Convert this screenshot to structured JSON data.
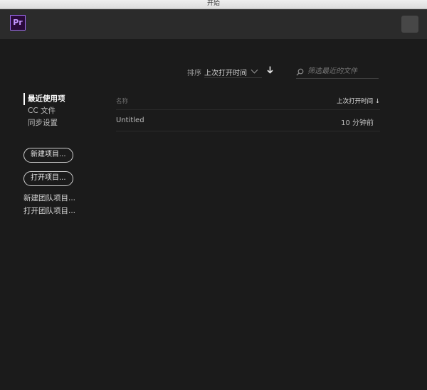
{
  "window": {
    "title": "开始"
  },
  "header": {
    "logo_text": "Pr"
  },
  "sort": {
    "label": "排序",
    "selected": "上次打开时间",
    "direction_icon": "arrow-down"
  },
  "search": {
    "placeholder": "筛选最近的文件",
    "value": ""
  },
  "sidebar": {
    "items": [
      {
        "label": "最近使用项",
        "active": true
      },
      {
        "label": "CC 文件",
        "active": false
      },
      {
        "label": "同步设置",
        "active": false
      }
    ]
  },
  "actions": {
    "new_project": "新建项目...",
    "open_project": "打开项目...",
    "new_team_project": "新建团队项目...",
    "open_team_project": "打开团队项目..."
  },
  "table": {
    "columns": {
      "name": "名称",
      "last_opened": "上次打开时间 ↓"
    },
    "rows": [
      {
        "name": "Untitled",
        "last_opened": "10 分钟前"
      }
    ]
  },
  "colors": {
    "accent": "#9f6cf0",
    "background": "#1b1b1b",
    "header_bg": "#2b2b2b"
  }
}
